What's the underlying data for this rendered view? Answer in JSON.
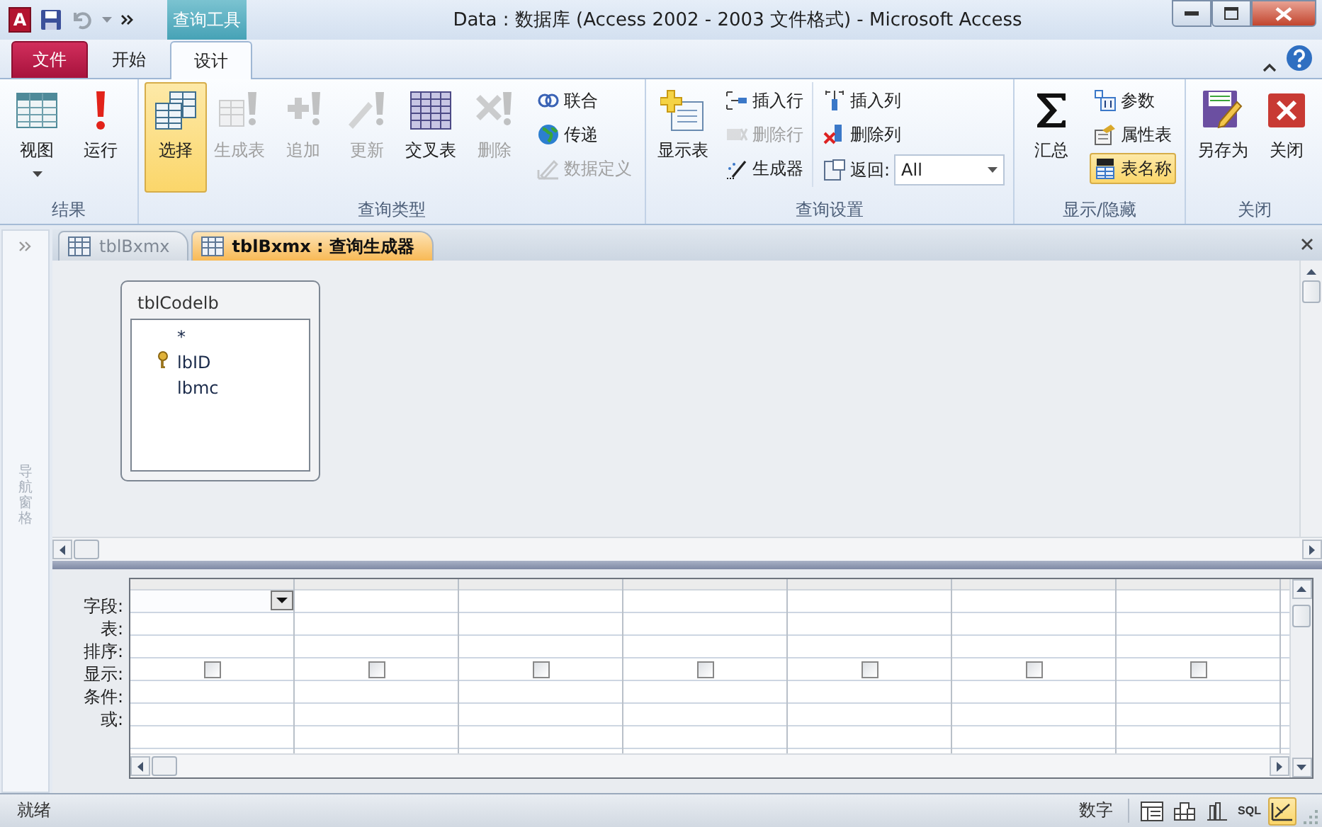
{
  "window": {
    "app_icon": "A",
    "title": "Data : 数据库 (Access 2002 - 2003 文件格式)  -  Microsoft Access",
    "context_group": "查询工具"
  },
  "ribbon_tabs": [
    {
      "label": "文件",
      "kind": "file",
      "selected": false
    },
    {
      "label": "开始",
      "kind": "tab",
      "selected": false
    },
    {
      "label": "设计",
      "kind": "tab",
      "selected": true
    }
  ],
  "ribbon_groups": [
    {
      "label": "结果",
      "buttons": [
        {
          "label": "视图",
          "disabled": false,
          "selected": false,
          "dropdown": true
        },
        {
          "label": "运行",
          "disabled": false,
          "selected": false
        }
      ]
    },
    {
      "label": "查询类型",
      "buttons": [
        {
          "label": "选择",
          "disabled": false,
          "selected": true
        },
        {
          "label": "生成表",
          "disabled": true,
          "selected": false
        },
        {
          "label": "追加",
          "disabled": true,
          "selected": false
        },
        {
          "label": "更新",
          "disabled": true,
          "selected": false
        },
        {
          "label": "交叉表",
          "disabled": false,
          "selected": false
        },
        {
          "label": "删除",
          "disabled": true,
          "selected": false
        }
      ],
      "columns": [
        [
          {
            "kind": "button",
            "label": "联合",
            "disabled": false,
            "selected": false
          },
          {
            "kind": "button",
            "label": "传递",
            "disabled": false,
            "selected": false
          },
          {
            "kind": "button",
            "label": "数据定义",
            "disabled": true,
            "selected": false
          }
        ]
      ]
    },
    {
      "label": "查询设置",
      "buttons": [
        {
          "label": "显示表",
          "disabled": false,
          "selected": false
        }
      ],
      "columns": [
        [
          {
            "kind": "button",
            "label": "插入行",
            "disabled": false,
            "selected": false
          },
          {
            "kind": "button",
            "label": "删除行",
            "disabled": true,
            "selected": false
          },
          {
            "kind": "button",
            "label": "生成器",
            "disabled": false,
            "selected": false
          }
        ],
        [
          {
            "kind": "button",
            "label": "插入列",
            "disabled": false,
            "selected": false
          },
          {
            "kind": "button",
            "label": "删除列",
            "disabled": false,
            "selected": false
          },
          {
            "kind": "select",
            "label": "返回:",
            "value": "All"
          }
        ]
      ]
    },
    {
      "label": "显示/隐藏",
      "buttons": [
        {
          "label": "汇总",
          "disabled": false,
          "selected": false
        }
      ],
      "columns": [
        [
          {
            "kind": "button",
            "label": "参数",
            "disabled": false,
            "selected": false
          },
          {
            "kind": "button",
            "label": "属性表",
            "disabled": false,
            "selected": false
          },
          {
            "kind": "button",
            "label": "表名称",
            "disabled": false,
            "selected": true
          }
        ]
      ]
    },
    {
      "label": "关闭",
      "buttons": [
        {
          "label": "另存为",
          "disabled": false,
          "selected": false
        },
        {
          "label": "关闭",
          "disabled": false,
          "selected": false
        }
      ]
    }
  ],
  "nav_pane": {
    "label": "导航窗格"
  },
  "document_tabs": [
    {
      "label": "tblBxmx",
      "selected": false
    },
    {
      "label": "tblBxmx : 查询生成器",
      "selected": true
    }
  ],
  "field_list": {
    "title": "tblCodelb",
    "fields": [
      {
        "name": "*",
        "primary_key": false
      },
      {
        "name": "lbID",
        "primary_key": true
      },
      {
        "name": "lbmc",
        "primary_key": false
      }
    ]
  },
  "design_grid": {
    "row_labels": [
      "字段:",
      "表:",
      "排序:",
      "显示:",
      "条件:",
      "或:"
    ],
    "columns": [
      {
        "show": false,
        "focused": true
      },
      {
        "show": false,
        "focused": false
      },
      {
        "show": false,
        "focused": false
      },
      {
        "show": false,
        "focused": false
      },
      {
        "show": false,
        "focused": false
      },
      {
        "show": false,
        "focused": false
      },
      {
        "show": false,
        "focused": false
      }
    ]
  },
  "status_bar": {
    "text": "就绪",
    "mode": "数字",
    "view_buttons": [
      {
        "kind": "icon",
        "selected": false
      },
      {
        "kind": "icon",
        "selected": false
      },
      {
        "kind": "icon",
        "selected": false
      },
      {
        "kind": "text",
        "label": "SQL",
        "selected": false
      },
      {
        "kind": "icon",
        "selected": true
      }
    ]
  }
}
